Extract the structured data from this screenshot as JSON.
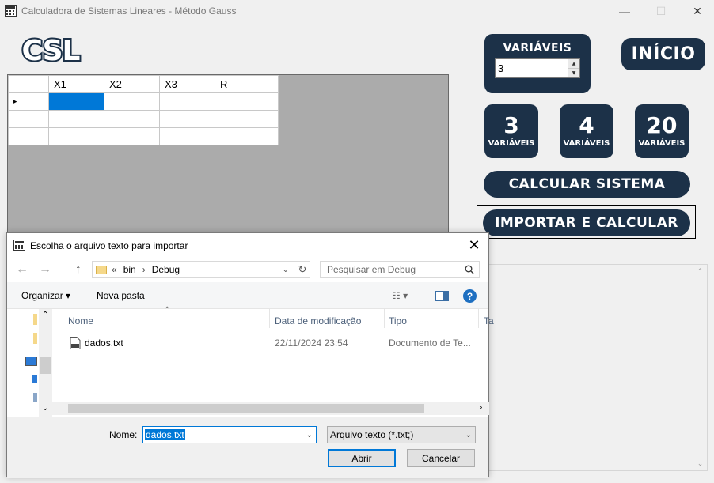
{
  "window": {
    "title": "Calculadora de Sistemas Lineares - Método Gauss",
    "minimize": "—",
    "maximize": "☐",
    "close": "✕"
  },
  "logo": {
    "text": "CSL"
  },
  "grid": {
    "columns": [
      "X1",
      "X2",
      "X3",
      "R"
    ],
    "row_indicator": "▸",
    "rows": 3
  },
  "variables": {
    "label": "VARIÁVEIS",
    "value": "3"
  },
  "home_button": "INÍCIO",
  "preset_buttons": [
    {
      "num": "3",
      "sub": "VARIÁVEIS"
    },
    {
      "num": "4",
      "sub": "VARIÁVEIS"
    },
    {
      "num": "20",
      "sub": "VARIÁVEIS"
    }
  ],
  "calc_button": "CALCULAR SISTEMA",
  "import_button": "IMPORTAR E CALCULAR",
  "dialog": {
    "title": "Escolha o arquivo texto para importar",
    "breadcrumb": [
      "«",
      "bin",
      "›",
      "Debug"
    ],
    "search_placeholder": "Pesquisar em Debug",
    "organize": "Organizar ▾",
    "new_folder": "Nova pasta",
    "columns": {
      "name": "Nome",
      "date": "Data de modificação",
      "type": "Tipo",
      "size": "Ta"
    },
    "files": [
      {
        "name": "dados.txt",
        "date": "22/11/2024 23:54",
        "type": "Documento de Te..."
      }
    ],
    "filename_label": "Nome:",
    "filename_value": "dados.txt",
    "filetype_value": "Arquivo texto  (*.txt;)",
    "open_button": "Abrir",
    "cancel_button": "Cancelar"
  },
  "colors": {
    "navy": "#1c3148",
    "selection": "#0078d7",
    "grid_bg": "#ababab"
  }
}
